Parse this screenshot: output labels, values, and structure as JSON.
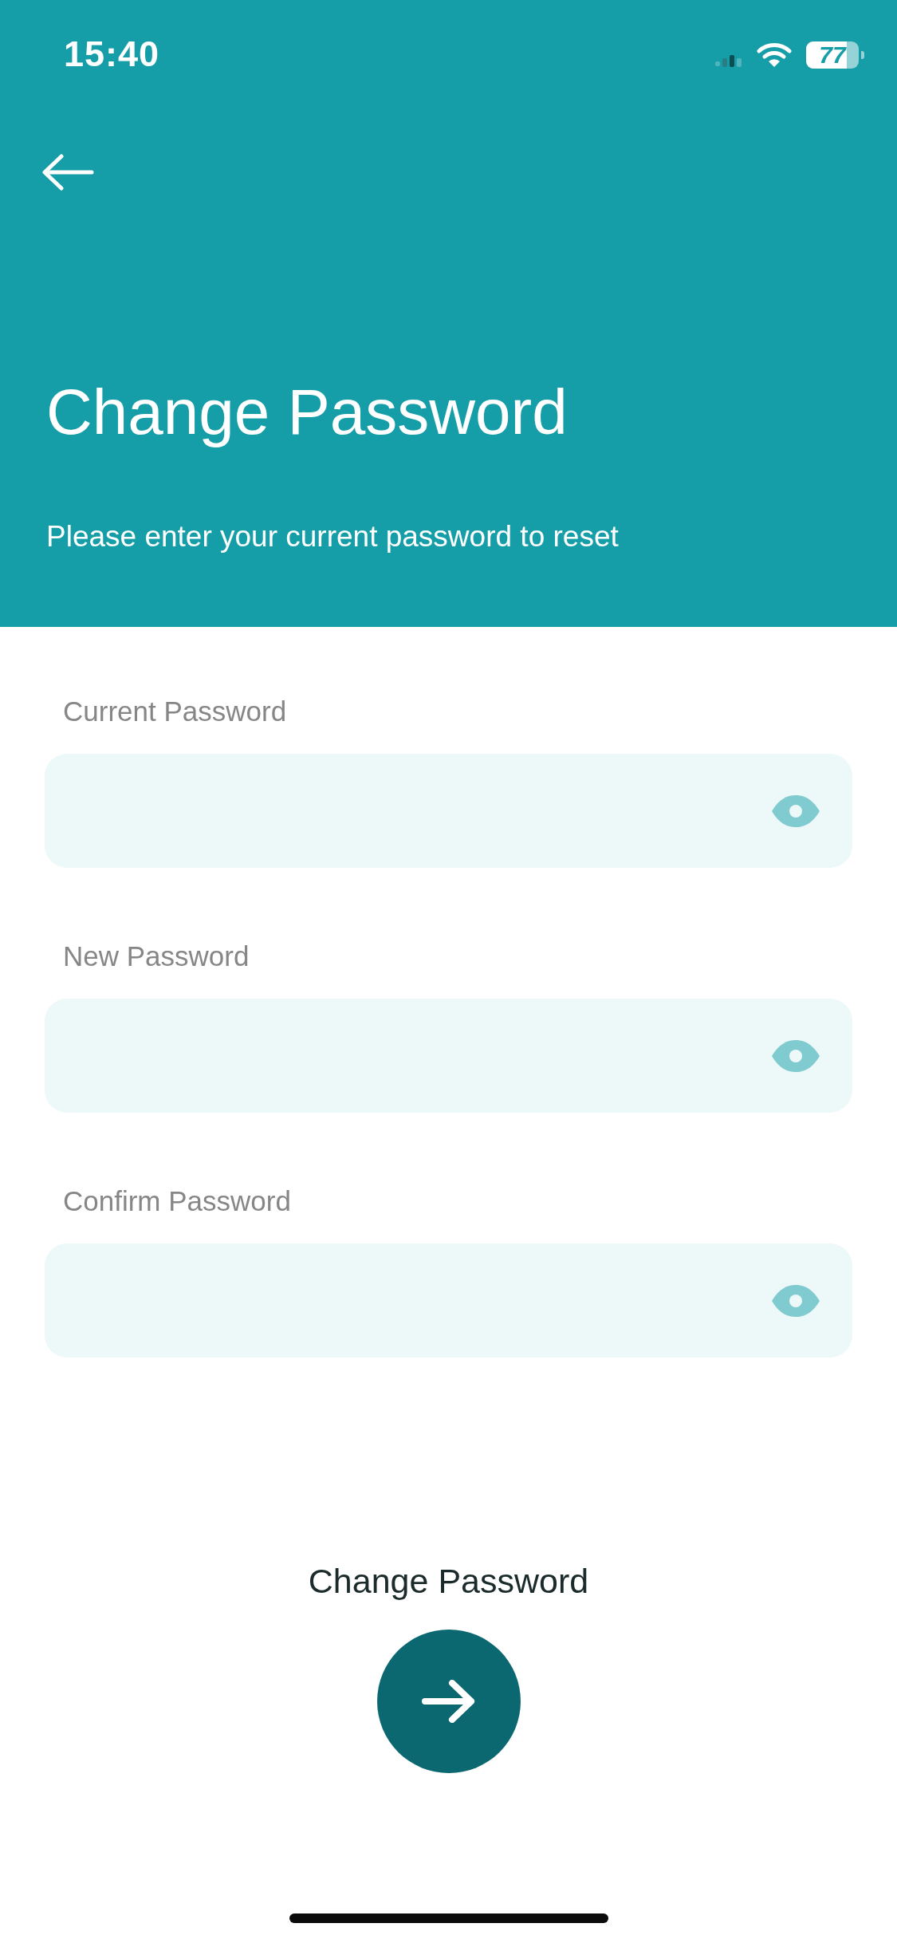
{
  "status_bar": {
    "time": "15:40",
    "battery": "77"
  },
  "header": {
    "title": "Change Password",
    "subtitle": "Please enter your current password to reset"
  },
  "fields": [
    {
      "label": "Current Password"
    },
    {
      "label": "New Password"
    },
    {
      "label": "Confirm Password"
    }
  ],
  "submit": {
    "label": "Change Password"
  }
}
